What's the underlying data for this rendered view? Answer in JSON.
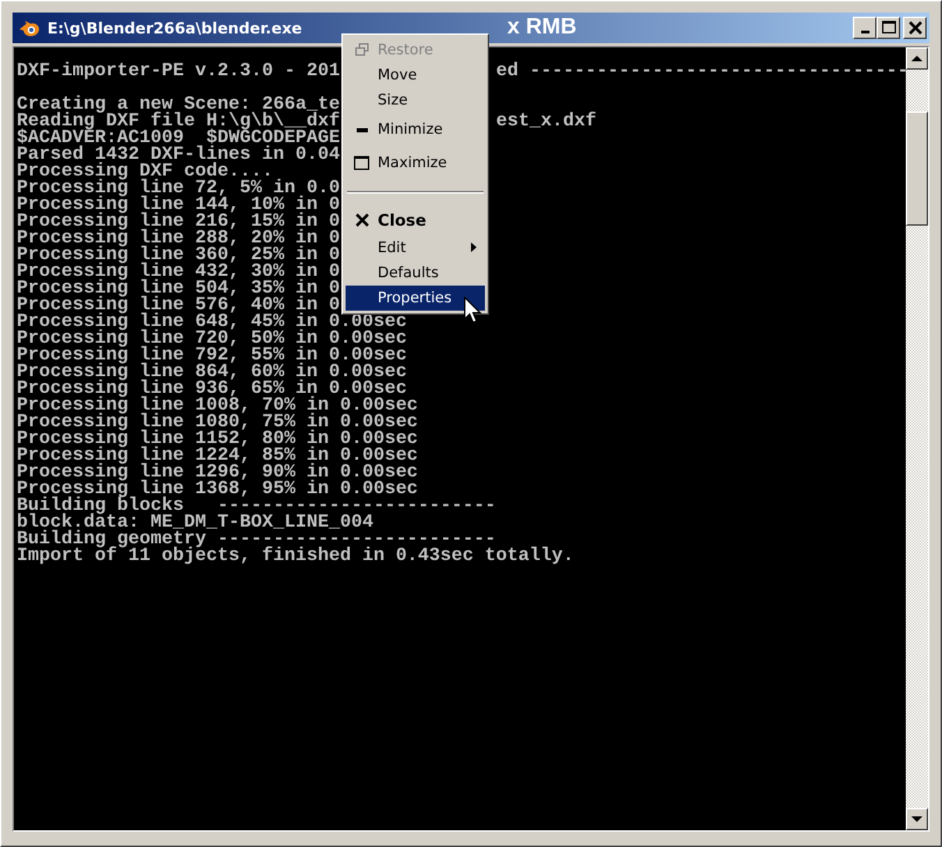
{
  "window": {
    "title": "E:\\g\\Blender266a\\blender.exe",
    "caption_note": "x RMB"
  },
  "console": {
    "lines": [
      {
        "kind": "text",
        "text": "DXF-importer-PE v.2.3.0 - 201",
        "tail": "ed ----------------------------------"
      },
      {
        "kind": "blank"
      },
      {
        "kind": "text",
        "text": "Creating a new Scene: 266a_te"
      },
      {
        "kind": "text",
        "text": "Reading DXF file H:\\g\\b\\__dxf",
        "tail": "est_x.dxf"
      },
      {
        "kind": "text",
        "text": "$ACADVER:AC1009  $DWGCODEPAGE"
      },
      {
        "kind": "text",
        "text": "Parsed 1432 DXF-lines in 0.04"
      },
      {
        "kind": "text",
        "text": "Processing DXF code...."
      },
      {
        "kind": "text",
        "text": "Processing line 72, 5% in 0.0"
      },
      {
        "kind": "text",
        "text": "Processing line 144, 10% in 0"
      },
      {
        "kind": "text",
        "text": "Processing line 216, 15% in 0"
      },
      {
        "kind": "text",
        "text": "Processing line 288, 20% in 0"
      },
      {
        "kind": "text",
        "text": "Processing line 360, 25% in 0"
      },
      {
        "kind": "text",
        "text": "Processing line 432, 30% in 0"
      },
      {
        "kind": "text",
        "text": "Processing line 504, 35% in 0"
      },
      {
        "kind": "text",
        "text": "Processing line 576, 40% in 0"
      },
      {
        "kind": "text",
        "text": "Processing line 648, 45% in 0.00sec"
      },
      {
        "kind": "text",
        "text": "Processing line 720, 50% in 0.00sec"
      },
      {
        "kind": "text",
        "text": "Processing line 792, 55% in 0.00sec"
      },
      {
        "kind": "text",
        "text": "Processing line 864, 60% in 0.00sec"
      },
      {
        "kind": "text",
        "text": "Processing line 936, 65% in 0.00sec"
      },
      {
        "kind": "text",
        "text": "Processing line 1008, 70% in 0.00sec"
      },
      {
        "kind": "text",
        "text": "Processing line 1080, 75% in 0.00sec"
      },
      {
        "kind": "text",
        "text": "Processing line 1152, 80% in 0.00sec"
      },
      {
        "kind": "text",
        "text": "Processing line 1224, 85% in 0.00sec"
      },
      {
        "kind": "text",
        "text": "Processing line 1296, 90% in 0.00sec"
      },
      {
        "kind": "text",
        "text": "Processing line 1368, 95% in 0.00sec"
      },
      {
        "kind": "text",
        "text": "Building blocks   -------------------------"
      },
      {
        "kind": "text",
        "text": "block.data: ME_DM_T-BOX_LINE_004"
      },
      {
        "kind": "text",
        "text": "Building geometry -------------------------"
      },
      {
        "kind": "text",
        "text": "Import of 11 objects, finished in 0.43sec totally."
      }
    ]
  },
  "context_menu": {
    "items": [
      {
        "kind": "item",
        "label": "Restore",
        "disabled": true,
        "selected": false
      },
      {
        "kind": "item",
        "label": "Move",
        "disabled": false,
        "selected": false
      },
      {
        "kind": "item",
        "label": "Size",
        "disabled": false,
        "selected": false
      },
      {
        "kind": "item",
        "label": "Minimize",
        "disabled": false,
        "selected": false
      },
      {
        "kind": "item",
        "label": "Maximize",
        "disabled": false,
        "selected": false
      },
      {
        "kind": "separator"
      },
      {
        "kind": "item",
        "label": "Close",
        "bold": true,
        "disabled": false,
        "selected": false
      },
      {
        "kind": "item",
        "label": "Edit",
        "submenu": true,
        "disabled": false,
        "selected": false
      },
      {
        "kind": "item",
        "label": "Defaults",
        "disabled": false,
        "selected": false
      },
      {
        "kind": "item",
        "label": "Properties",
        "disabled": false,
        "selected": true
      }
    ]
  }
}
